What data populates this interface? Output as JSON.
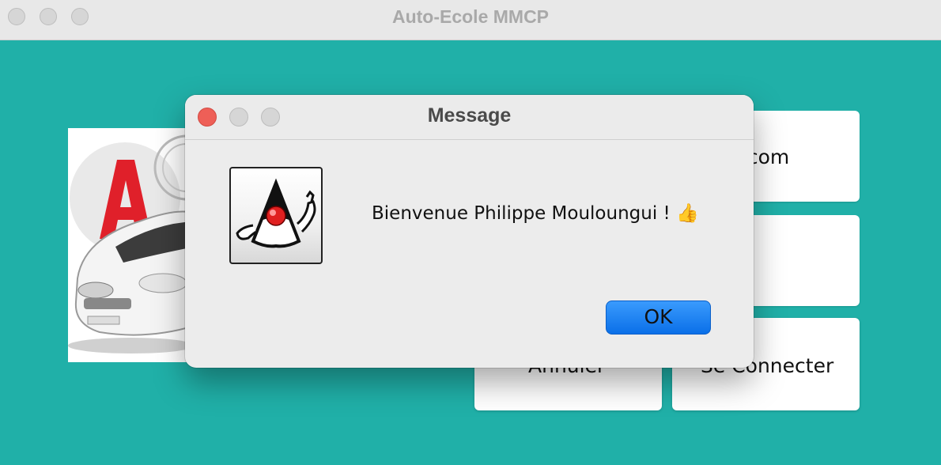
{
  "window": {
    "title": "Auto-Ecole MMCP"
  },
  "form": {
    "email_value_visible": "l.com",
    "cancel_label_visible": "Annuler",
    "login_label_visible": "Se Connecter"
  },
  "dialog": {
    "title": "Message",
    "message": "Bienvenue Philippe Mouloungui ! 👍",
    "ok_label": "OK",
    "icon": "java-duke-icon"
  },
  "colors": {
    "background": "#20b0a8",
    "ok_button": "#0a6fe8",
    "close_red": "#ee5f57"
  }
}
